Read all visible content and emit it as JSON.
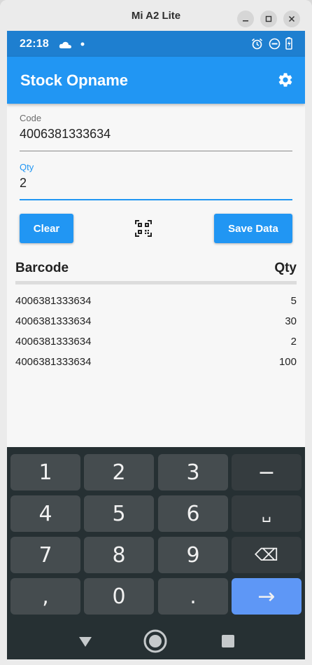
{
  "window": {
    "title": "Mi A2 Lite"
  },
  "statusbar": {
    "time": "22:18"
  },
  "app": {
    "title": "Stock Opname",
    "code_field": {
      "label": "Code",
      "value": "4006381333634"
    },
    "qty_field": {
      "label": "Qty",
      "value": "2"
    },
    "clear_label": "Clear",
    "save_label": "Save Data",
    "table": {
      "headers": {
        "barcode": "Barcode",
        "qty": "Qty"
      },
      "rows": [
        {
          "barcode": "4006381333634",
          "qty": "5"
        },
        {
          "barcode": "4006381333634",
          "qty": "30"
        },
        {
          "barcode": "4006381333634",
          "qty": "2"
        },
        {
          "barcode": "4006381333634",
          "qty": "100"
        }
      ]
    }
  },
  "keyboard": {
    "keys": [
      "1",
      "2",
      "3",
      "−",
      "4",
      "5",
      "6",
      "␣",
      "7",
      "8",
      "9",
      "⌫",
      ",",
      "0",
      ".",
      "→"
    ]
  },
  "colors": {
    "primary": "#2196f3",
    "statusbar": "#1e7fd0",
    "keyboard_bg": "#263033",
    "enter_key": "#5e97f6"
  }
}
